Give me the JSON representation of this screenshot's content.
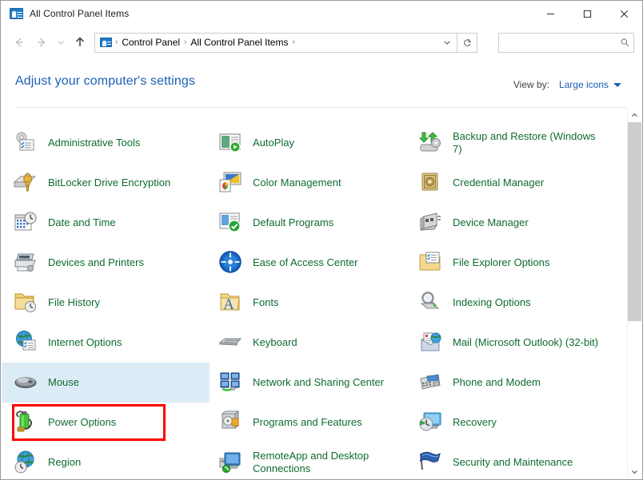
{
  "window": {
    "title": "All Control Panel Items",
    "icon": "control-panel-icon",
    "controls": {
      "minimize": "—",
      "maximize": "□",
      "close": "✕"
    }
  },
  "navbar": {
    "back_tooltip": "Back",
    "forward_tooltip": "Forward",
    "recent_tooltip": "Recent locations",
    "up_tooltip": "Up",
    "breadcrumbs": [
      "Control Panel",
      "All Control Panel Items"
    ],
    "separator": "›",
    "dropdown": "chevron-down-icon",
    "refresh": "refresh-icon",
    "search": {
      "value": "",
      "placeholder": "",
      "icon": "search-icon"
    }
  },
  "page": {
    "heading": "Adjust your computer's settings",
    "view_by_label": "View by:",
    "view_by_value": "Large icons"
  },
  "colors": {
    "link": "#1a5fb4",
    "item_text": "#0e6b31",
    "highlight": "#dcecf7",
    "annotation": "#ff0000",
    "titlebar_text": "#1b1b1b"
  },
  "items": [
    {
      "label": "Administrative Tools",
      "icon": "administrative-tools-icon",
      "col": 0,
      "row": 0
    },
    {
      "label": "AutoPlay",
      "icon": "autoplay-icon",
      "col": 1,
      "row": 0
    },
    {
      "label": "Backup and Restore (Windows 7)",
      "icon": "backup-restore-icon",
      "col": 2,
      "row": 0
    },
    {
      "label": "BitLocker Drive Encryption",
      "icon": "bitlocker-icon",
      "col": 0,
      "row": 1
    },
    {
      "label": "Color Management",
      "icon": "color-management-icon",
      "col": 1,
      "row": 1
    },
    {
      "label": "Credential Manager",
      "icon": "credential-manager-icon",
      "col": 2,
      "row": 1
    },
    {
      "label": "Date and Time",
      "icon": "date-time-icon",
      "col": 0,
      "row": 2
    },
    {
      "label": "Default Programs",
      "icon": "default-programs-icon",
      "col": 1,
      "row": 2
    },
    {
      "label": "Device Manager",
      "icon": "device-manager-icon",
      "col": 2,
      "row": 2
    },
    {
      "label": "Devices and Printers",
      "icon": "devices-printers-icon",
      "col": 0,
      "row": 3
    },
    {
      "label": "Ease of Access Center",
      "icon": "ease-of-access-icon",
      "col": 1,
      "row": 3
    },
    {
      "label": "File Explorer Options",
      "icon": "file-explorer-options-icon",
      "col": 2,
      "row": 3
    },
    {
      "label": "File History",
      "icon": "file-history-icon",
      "col": 0,
      "row": 4
    },
    {
      "label": "Fonts",
      "icon": "fonts-icon",
      "col": 1,
      "row": 4
    },
    {
      "label": "Indexing Options",
      "icon": "indexing-options-icon",
      "col": 2,
      "row": 4
    },
    {
      "label": "Internet Options",
      "icon": "internet-options-icon",
      "col": 0,
      "row": 5
    },
    {
      "label": "Keyboard",
      "icon": "keyboard-icon",
      "col": 1,
      "row": 5
    },
    {
      "label": "Mail (Microsoft Outlook) (32-bit)",
      "icon": "mail-icon",
      "col": 2,
      "row": 5
    },
    {
      "label": "Mouse",
      "icon": "mouse-icon",
      "col": 0,
      "row": 6,
      "state": "hover"
    },
    {
      "label": "Network and Sharing Center",
      "icon": "network-sharing-icon",
      "col": 1,
      "row": 6
    },
    {
      "label": "Phone and Modem",
      "icon": "phone-modem-icon",
      "col": 2,
      "row": 6
    },
    {
      "label": "Power Options",
      "icon": "power-options-icon",
      "col": 0,
      "row": 7,
      "state": "annotated"
    },
    {
      "label": "Programs and Features",
      "icon": "programs-features-icon",
      "col": 1,
      "row": 7
    },
    {
      "label": "Recovery",
      "icon": "recovery-icon",
      "col": 2,
      "row": 7
    },
    {
      "label": "Region",
      "icon": "region-icon",
      "col": 0,
      "row": 8
    },
    {
      "label": "RemoteApp and Desktop Connections",
      "icon": "remoteapp-icon",
      "col": 1,
      "row": 8
    },
    {
      "label": "Security and Maintenance",
      "icon": "security-maintenance-icon",
      "col": 2,
      "row": 8
    }
  ],
  "scrollbar": {
    "up_arrow": "chevron-up-icon",
    "down_arrow": "chevron-down-icon",
    "thumb_position_percent": 0,
    "thumb_size_percent": 58
  }
}
